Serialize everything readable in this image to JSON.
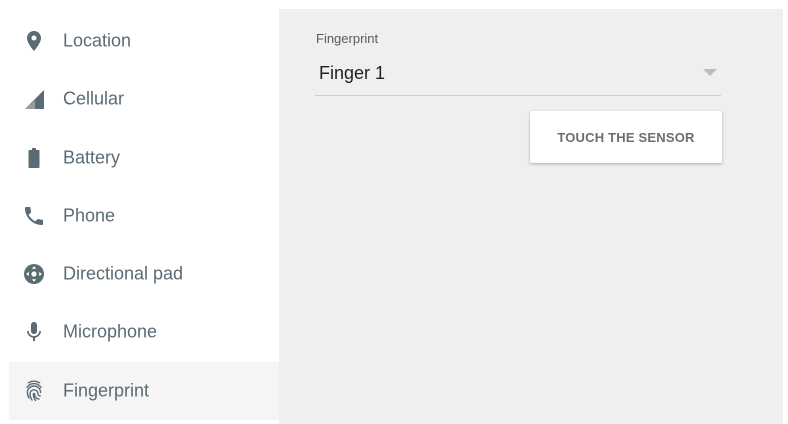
{
  "sidebar": {
    "items": [
      {
        "label": "Location",
        "icon": "location-pin-icon",
        "active": false
      },
      {
        "label": "Cellular",
        "icon": "cellular-signal-icon",
        "active": false
      },
      {
        "label": "Battery",
        "icon": "battery-icon",
        "active": false
      },
      {
        "label": "Phone",
        "icon": "phone-icon",
        "active": false
      },
      {
        "label": "Directional pad",
        "icon": "dpad-icon",
        "active": false
      },
      {
        "label": "Microphone",
        "icon": "microphone-icon",
        "active": false
      },
      {
        "label": "Fingerprint",
        "icon": "fingerprint-icon",
        "active": true
      }
    ]
  },
  "panel": {
    "field_label": "Fingerprint",
    "selected_value": "Finger 1",
    "button_label": "TOUCH THE SENSOR"
  },
  "colors": {
    "icon": "#5a6b74",
    "label": "#5a6b74",
    "panel_bg": "#efefef",
    "active_item_bg": "#f5f5f5"
  }
}
